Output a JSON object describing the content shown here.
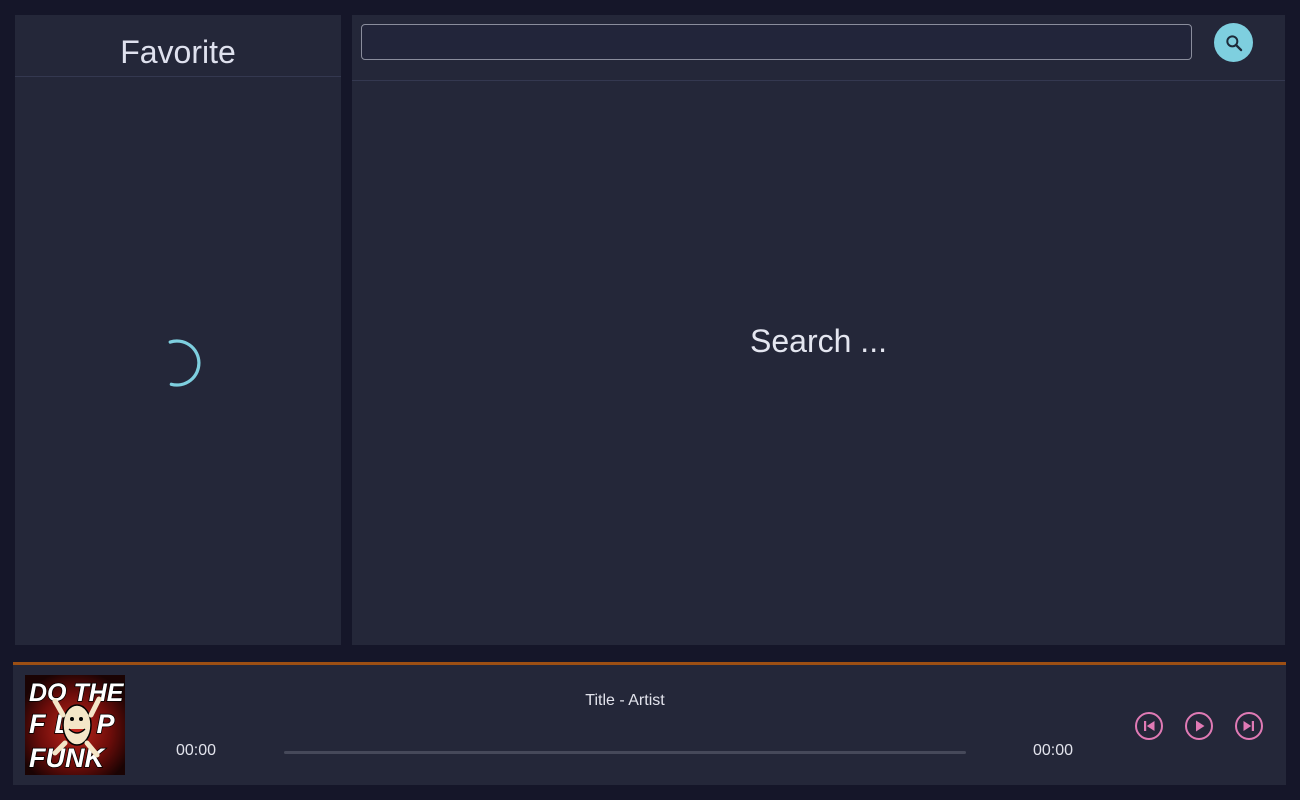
{
  "favorites": {
    "title": "Favorite",
    "loading": true
  },
  "search": {
    "input_value": "",
    "placeholder": "",
    "button_icon": "search-icon",
    "empty_message": "Search ..."
  },
  "player": {
    "track_label": "Title - Artist",
    "time_current": "00:00",
    "time_total": "00:00",
    "progress": 0,
    "cover_art_text": [
      "DO THE",
      "FLIP",
      "FUNK"
    ],
    "controls": {
      "previous_icon": "skip-previous-icon",
      "play_icon": "play-icon",
      "next_icon": "skip-next-icon"
    }
  },
  "colors": {
    "background": "#151629",
    "panel": "#242739",
    "accent_cyan": "#7ecfdf",
    "accent_pink": "#e07ab5",
    "accent_orange": "#9c4f14",
    "text": "#e2e3ec"
  }
}
